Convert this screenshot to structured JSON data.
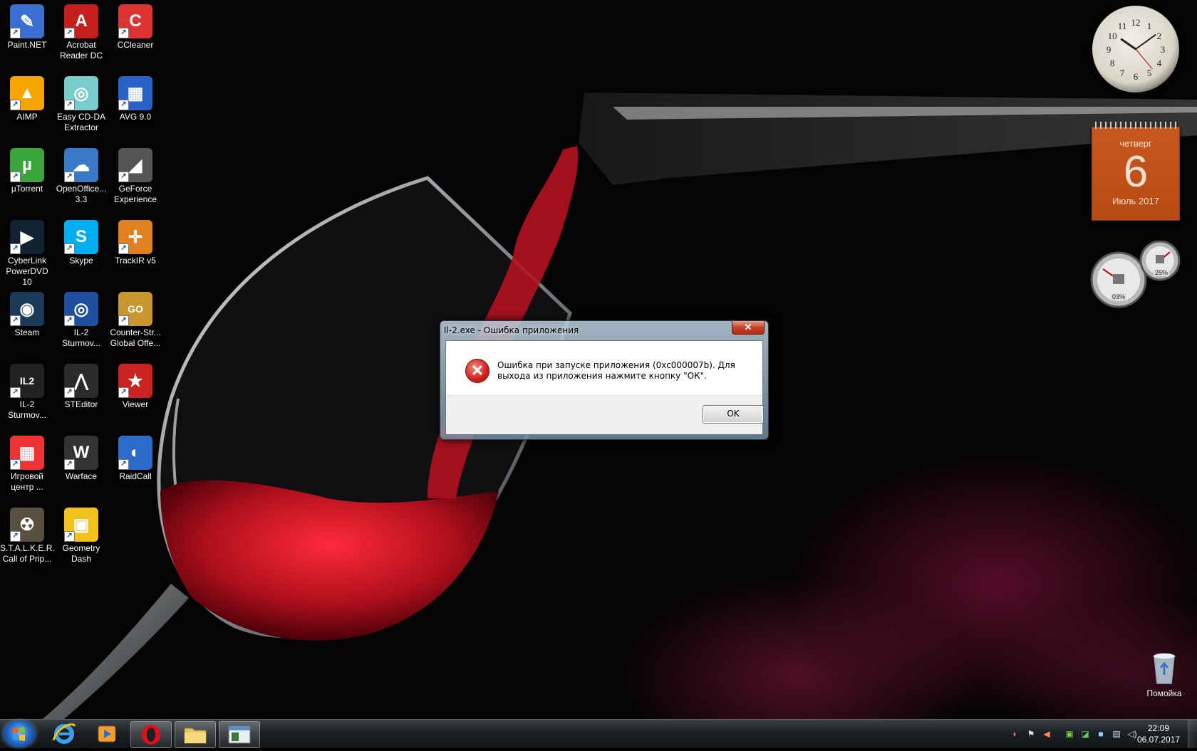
{
  "desktop": {
    "icons": [
      {
        "label": "Paint.NET",
        "icon": "paint-net-icon",
        "color": "#3a6fd0"
      },
      {
        "label": "Acrobat Reader DC",
        "icon": "acrobat-icon",
        "color": "#c41e1e"
      },
      {
        "label": "CCleaner",
        "icon": "ccleaner-icon",
        "color": "#d33"
      },
      {
        "label": "AIMP",
        "icon": "aimp-icon",
        "color": "#f5a400"
      },
      {
        "label": "Easy CD-DA Extractor",
        "icon": "cd-extractor-icon",
        "color": "#7cc"
      },
      {
        "label": "AVG 9.0",
        "icon": "avg-icon",
        "color": "#2b62c8"
      },
      {
        "label": "µTorrent",
        "icon": "utorrent-icon",
        "color": "#3ca63c"
      },
      {
        "label": "OpenOffice... 3.3",
        "icon": "openoffice-icon",
        "color": "#3a78c8"
      },
      {
        "label": "GeForce Experience",
        "icon": "geforce-icon",
        "color": "#555"
      },
      {
        "label": "CyberLink PowerDVD 10",
        "icon": "powerdvd-icon",
        "color": "#123"
      },
      {
        "label": "Skype",
        "icon": "skype-icon",
        "color": "#00aff0"
      },
      {
        "label": "TrackIR v5",
        "icon": "trackir-icon",
        "color": "#e08020"
      },
      {
        "label": "Steam",
        "icon": "steam-icon",
        "color": "#1b3a5a"
      },
      {
        "label": "IL-2 Sturmov...",
        "icon": "il2-roundel-icon",
        "color": "#1f4f9f"
      },
      {
        "label": "Counter-Str... Global Offe...",
        "icon": "csgo-icon",
        "color": "#c8962e"
      },
      {
        "label": "IL-2 Sturmov...",
        "icon": "il2-logo-icon",
        "color": "#222"
      },
      {
        "label": "STEditor",
        "icon": "compass-icon",
        "color": "#2a2a2a"
      },
      {
        "label": "Viewer",
        "icon": "star-viewer-icon",
        "color": "#cc2222"
      },
      {
        "label": "Игровой центр ...",
        "icon": "rubiks-cube-icon",
        "color": "#e33"
      },
      {
        "label": "Warface",
        "icon": "warface-icon",
        "color": "#333"
      },
      {
        "label": "RaidCall",
        "icon": "raidcall-icon",
        "color": "#2b6cc8"
      },
      {
        "label": "S.T.A.L.K.E.R. Call of Prip...",
        "icon": "radiation-icon",
        "color": "#5a5040"
      },
      {
        "label": "Geometry Dash",
        "icon": "geometry-dash-icon",
        "color": "#f2c21b"
      }
    ],
    "recycle_bin": {
      "label": "Помойка",
      "icon": "recycle-bin-icon"
    }
  },
  "gadgets": {
    "clock": {
      "hours": [
        "12",
        "1",
        "2",
        "3",
        "4",
        "5",
        "6",
        "7",
        "8",
        "9",
        "10",
        "11"
      ],
      "time": "22:09"
    },
    "calendar": {
      "weekday": "четверг",
      "day": "6",
      "month_year": "Июль 2017"
    },
    "cpu_meter": {
      "cpu": "03%",
      "ram": "25%"
    }
  },
  "dialog": {
    "title": "Il-2.exe - Ошибка приложения",
    "close_label": "✕",
    "message": "Ошибка при запуске приложения (0xc000007b). Для выхода из приложения нажмите кнопку \"ОК\".",
    "ok_label": "OK"
  },
  "taskbar": {
    "buttons": [
      {
        "icon": "internet-explorer-icon"
      },
      {
        "icon": "media-player-icon"
      },
      {
        "icon": "opera-icon"
      },
      {
        "icon": "file-explorer-icon"
      },
      {
        "icon": "il2-window-icon",
        "active": true
      }
    ],
    "clock_time": "22:09",
    "clock_date": "06.07.2017"
  }
}
